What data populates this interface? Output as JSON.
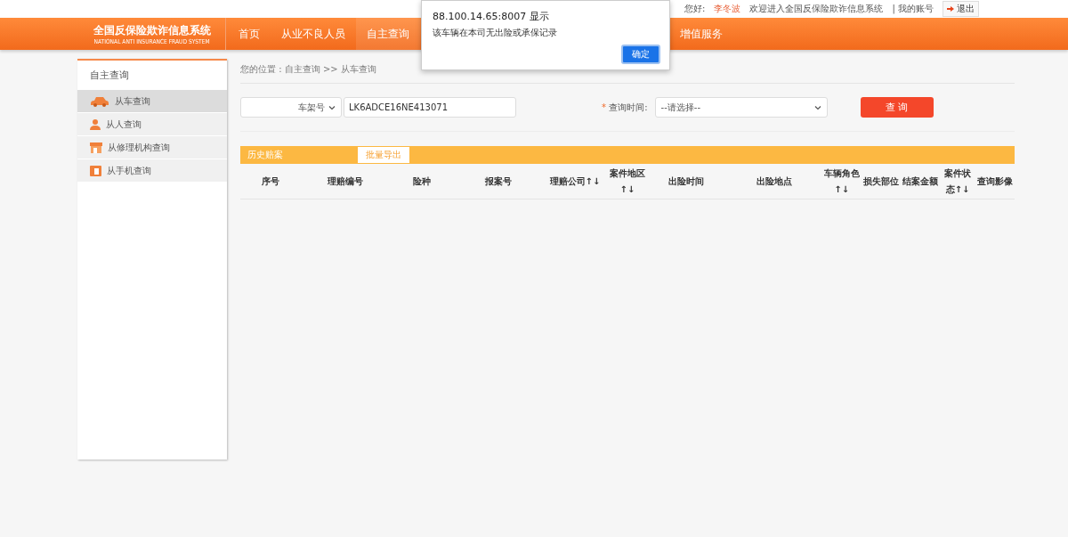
{
  "top_bar": {
    "greeting": "您好:",
    "user": "李冬波",
    "welcome": "欢迎进入全国反保险欺诈信息系统",
    "account": "| 我的账号",
    "logout": "退出"
  },
  "logo": {
    "title": "全国反保险欺诈信息系统",
    "subtitle": "NATIONAL ANTI INSURANCE FRAUD SYSTEM"
  },
  "nav": [
    {
      "label": "首页",
      "selected": false
    },
    {
      "label": "从业不良人员",
      "selected": false
    },
    {
      "label": "自主查询",
      "selected": true
    },
    {
      "label": "增值服务",
      "selected": false
    }
  ],
  "sidebar": {
    "title": "自主查询",
    "items": [
      {
        "label": "从车查询",
        "kind": "car",
        "selected": true
      },
      {
        "label": "从人查询",
        "kind": "person",
        "selected": false
      },
      {
        "label": "从修理机构查询",
        "kind": "shop",
        "selected": false
      },
      {
        "label": "从手机查询",
        "kind": "phone",
        "selected": false
      }
    ]
  },
  "breadcrumb": "您的位置 : 自主查询 >> 从车查询",
  "search": {
    "type_select": "车架号",
    "value": "LK6ADCE16NE413071",
    "required_mark": "*",
    "time_label": "查询时间:",
    "time_select": "--请选择--",
    "button": "查 询"
  },
  "history": {
    "title": "历史赔案",
    "export": "批量导出"
  },
  "table": {
    "columns": [
      "序号",
      "理赔编号",
      "险种",
      "报案号",
      "理赔公司↑↓",
      "案件地区↑↓",
      "出险时间",
      "出险地点",
      "车辆角色↑↓",
      "损失部位",
      "结案金额",
      "案件状态↑↓",
      "查询影像"
    ]
  },
  "dialog": {
    "title": "88.100.14.65:8007 显示",
    "message": "该车辆在本司无出险或承保记录",
    "button": "确定"
  }
}
